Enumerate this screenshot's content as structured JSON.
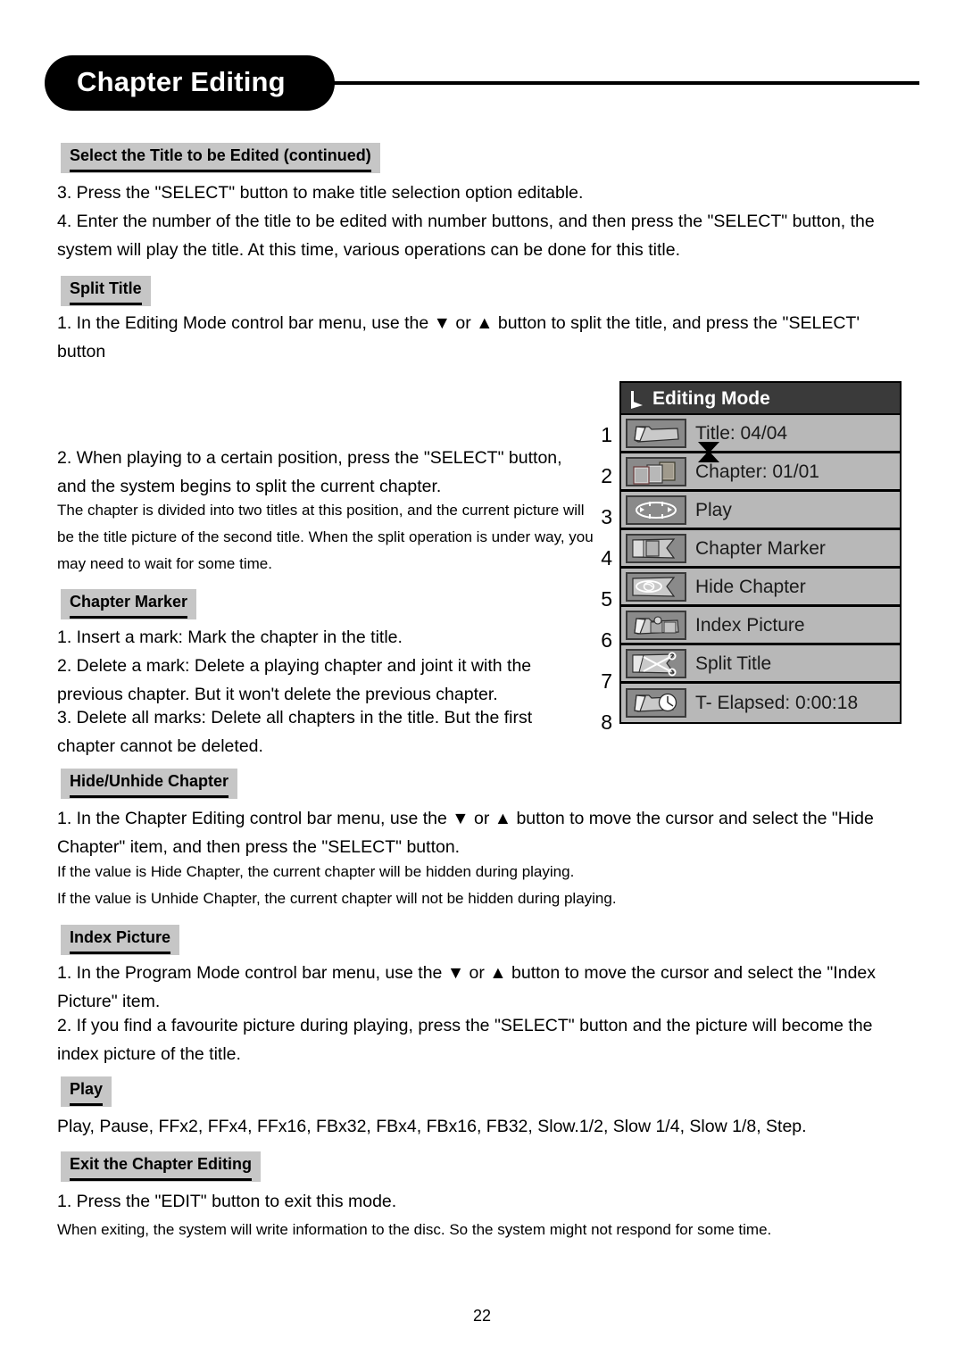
{
  "header": {
    "title": "Chapter Editing"
  },
  "sections": {
    "select_title": {
      "heading": "Select the Title to be Edited (continued)",
      "paragraphs": [
        "3. Press the \"SELECT\" button to make title selection option editable.",
        "4. Enter the number of the title to be edited with number buttons, and then press the \"SELECT\" button, the system will play the title. At this time, various operations can be done for this title."
      ]
    },
    "split_title": {
      "heading": "Split Title",
      "paragraphs": [
        "1. In the Editing Mode control bar menu, use the ▼ or ▲ button to split the title, and press the \"SELECT' button",
        "2. When playing to a certain position, press the \"SELECT\" button, and the system begins to split the current chapter."
      ],
      "note": "The chapter is divided into two titles at this position, and the current picture will be the title picture of the second title. When the split operation is under way, you may need to wait for some time."
    },
    "chapter_marker": {
      "heading": "Chapter Marker",
      "paragraphs": [
        "1. Insert a mark: Mark the chapter in the title.",
        "2. Delete a mark: Delete a playing chapter and joint it with the previous chapter. But it won't delete the previous chapter.",
        "3. Delete all marks: Delete all chapters in the title. But the first chapter cannot be deleted."
      ]
    },
    "hide_unhide": {
      "heading": "Hide/Unhide Chapter",
      "paragraphs": [
        "1. In the Chapter Editing control bar menu, use the ▼ or ▲ button to move the cursor and select the \"Hide Chapter\" item, and then press the \"SELECT\" button."
      ],
      "notes": [
        "If the value is Hide Chapter, the current chapter will be hidden during playing.",
        "If the value is Unhide Chapter, the current chapter will not be hidden during playing."
      ]
    },
    "index_picture": {
      "heading": "Index Picture",
      "paragraphs": [
        "1. In the Program Mode control bar menu, use the ▼ or ▲ button to move the cursor and select the \"Index Picture\" item.",
        "2. If you find a favourite picture during playing, press the \"SELECT\" button and the picture will become the index picture of the title."
      ]
    },
    "play": {
      "heading": "Play",
      "paragraphs": [
        "Play, Pause, FFx2, FFx4, FFx16, FBx32, FBx4, FBx16, FB32, Slow.1/2,  Slow 1/4, Slow 1/8, Step."
      ]
    },
    "exit": {
      "heading": "Exit the Chapter Editing",
      "paragraphs": [
        "1. Press the \"EDIT\" button to exit this mode."
      ],
      "notes": [
        "When exiting, the system will write information to the disc. So the system might not respond for some time."
      ]
    }
  },
  "osd": {
    "title": "Editing Mode",
    "rows": [
      {
        "number": "1",
        "icon": "title-folder-icon",
        "label": "Title: 04/04"
      },
      {
        "number": "2",
        "icon": "chapter-frames-icon",
        "label": "Chapter: 01/01"
      },
      {
        "number": "3",
        "icon": "play-disc-icon",
        "label": "Play"
      },
      {
        "number": "4",
        "icon": "chapter-marker-flag-icon",
        "label": "Chapter Marker"
      },
      {
        "number": "5",
        "icon": "hide-chapter-eye-icon",
        "label": "Hide Chapter"
      },
      {
        "number": "6",
        "icon": "index-picture-icon",
        "label": "Index Picture"
      },
      {
        "number": "7",
        "icon": "split-title-scissors-icon",
        "label": "Split Title"
      },
      {
        "number": "8",
        "icon": "elapsed-clock-icon",
        "label": "T- Elapsed: 0:00:18"
      }
    ],
    "colors": {
      "titlebar": "#3a3a3a",
      "row": "#b8b8b8",
      "icon_bg": "#8a8a8a",
      "border": "#000000"
    }
  },
  "footer": {
    "page_number": "22"
  }
}
